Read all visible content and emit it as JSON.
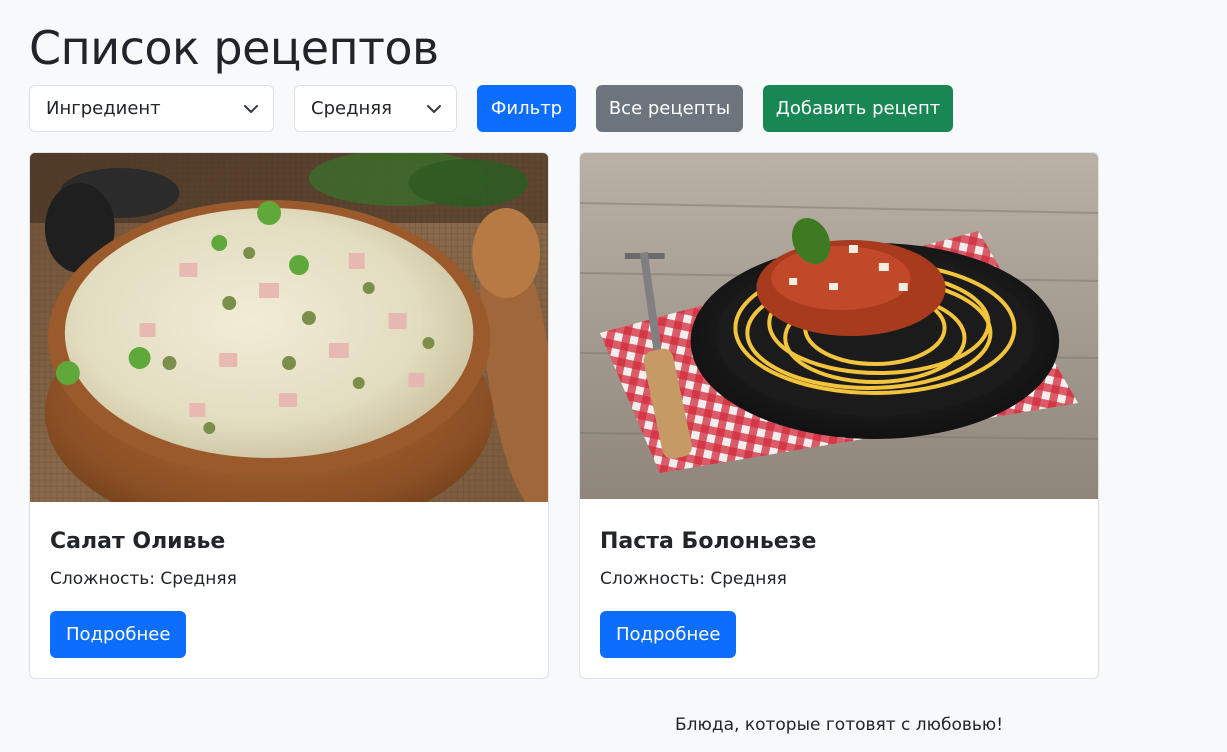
{
  "page": {
    "title": "Список рецептов",
    "footer": "Блюда, которые готовят с любовью!"
  },
  "filters": {
    "ingredient_select": {
      "value": "Ингредиент",
      "icon": "chevron-down-icon"
    },
    "difficulty_select": {
      "value": "Средняя",
      "icon": "chevron-down-icon"
    },
    "filter_button": "Фильтр",
    "all_recipes_button": "Все рецепты",
    "add_recipe_button": "Добавить рецепт"
  },
  "recipes": [
    {
      "title": "Салат Оливье",
      "difficulty": "Сложность: Средняя",
      "details_button": "Подробнее",
      "image": "olivier-salad-photo"
    },
    {
      "title": "Паста Болоньезе",
      "difficulty": "Сложность: Средняя",
      "details_button": "Подробнее",
      "image": "pasta-bolognese-photo"
    }
  ],
  "colors": {
    "background": "#f8f9fa",
    "primary": "#0d6efd",
    "secondary": "#6c757d",
    "success": "#198754",
    "border": "#dee2e6"
  }
}
